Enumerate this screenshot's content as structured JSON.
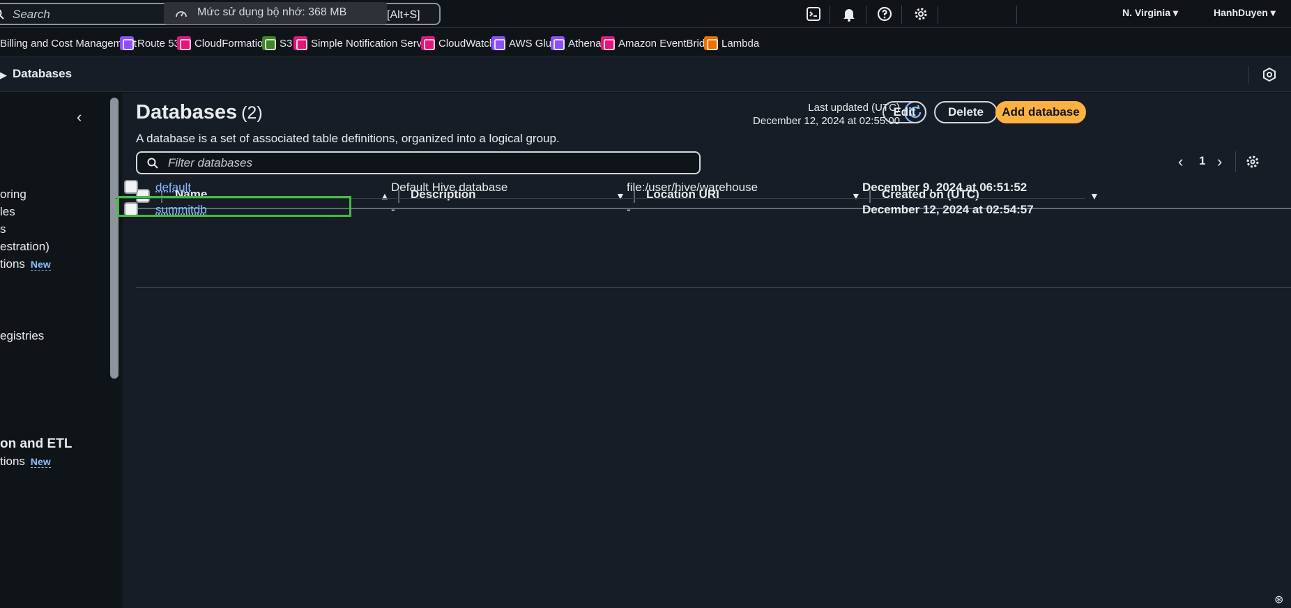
{
  "topbar": {
    "search_placeholder": "Search",
    "memory_text": "Mức sử dụng bộ nhớ: 368 MB",
    "shortcut": "[Alt+S]",
    "region": "N. Virginia",
    "user": "HanhDuyen"
  },
  "favorites": [
    {
      "label": "Billing and Cost Management",
      "icon": "billing-icon",
      "color": "#3f4a55"
    },
    {
      "label": "Route 53",
      "icon": "route53-icon",
      "color": "#8c4fff"
    },
    {
      "label": "CloudFormation",
      "icon": "cloudformation-icon",
      "color": "#e7157b"
    },
    {
      "label": "S3",
      "icon": "s3-icon",
      "color": "#3f8624"
    },
    {
      "label": "Simple Notification Service",
      "icon": "sns-icon",
      "color": "#e7157b"
    },
    {
      "label": "CloudWatch",
      "icon": "cloudwatch-icon",
      "color": "#e7157b"
    },
    {
      "label": "AWS Glue",
      "icon": "glue-icon",
      "color": "#8c4fff"
    },
    {
      "label": "Athena",
      "icon": "athena-icon",
      "color": "#8c4fff"
    },
    {
      "label": "Amazon EventBridge",
      "icon": "eventbridge-icon",
      "color": "#e7157b"
    },
    {
      "label": "Lambda",
      "icon": "lambda-icon",
      "color": "#ed7100"
    }
  ],
  "breadcrumb": {
    "current": "Databases"
  },
  "sidebar": {
    "items": [
      {
        "label": "oring"
      },
      {
        "label": "les"
      },
      {
        "label": "s"
      },
      {
        "label": "estration)"
      },
      {
        "label": "tions",
        "badge": "New"
      },
      {
        "label": "egistries"
      }
    ],
    "section_heading": "on and ETL",
    "section_item": {
      "label": "tions",
      "badge": "New"
    }
  },
  "main": {
    "title": "Databases",
    "count": "(2)",
    "description": "A database is a set of associated table definitions, organized into a logical group.",
    "last_updated_label": "Last updated (UTC)",
    "last_updated_value": "December 12, 2024 at 02:55:00",
    "buttons": {
      "edit": "Edit",
      "delete": "Delete",
      "add": "Add database"
    },
    "filter_placeholder": "Filter databases",
    "page": "1",
    "columns": [
      "Name",
      "Description",
      "Location URI",
      "Created on (UTC)"
    ],
    "rows": [
      {
        "name": "default",
        "description": "Default Hive database",
        "location": "file:/user/hive/warehouse",
        "created": "December 9, 2024 at 06:51:52"
      },
      {
        "name": "summitdb",
        "description": "-",
        "location": "-",
        "created": "December 12, 2024 at 02:54:57"
      }
    ]
  },
  "colors": {
    "accent": "#ffb23f",
    "link": "#89bdff",
    "highlight": "#3fbf3f"
  }
}
